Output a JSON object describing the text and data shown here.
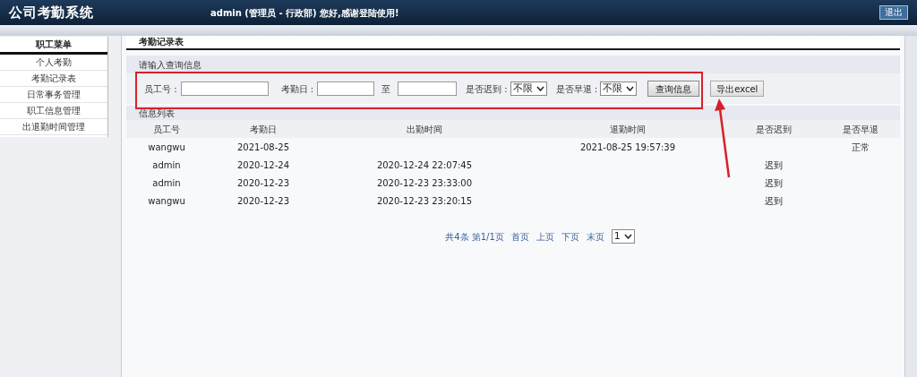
{
  "header": {
    "title": "公司考勤系统",
    "greeting": "admin (管理员 - 行政部) 您好,感谢登陆使用!",
    "logout": "退出"
  },
  "sidebar": {
    "heading": "职工菜单",
    "items": [
      "个人考勤",
      "考勤记录表",
      "日常事务管理",
      "职工信息管理",
      "出退勤时间管理"
    ]
  },
  "panel": {
    "title": "考勤记录表",
    "query_heading": "请输入查询信息",
    "filters": [
      {
        "kind": "input",
        "label": "员工号 :"
      },
      {
        "kind": "range",
        "label": "考勤日 :",
        "separator": "至"
      },
      {
        "kind": "select",
        "label": "是否迟到 :",
        "value": "不限"
      },
      {
        "kind": "select",
        "label": "是否早退 :",
        "value": "不限"
      }
    ],
    "buttons": [
      "查询信息",
      "导出excel"
    ],
    "list_heading": "信息列表",
    "table": {
      "columns": [
        "员工号",
        "考勤日",
        "出勤时间",
        "退勤时间",
        "是否迟到",
        "是否早退"
      ],
      "rows": [
        {
          "cells": [
            "wangwu",
            "2021-08-25",
            null,
            "2021-08-25 19:57:39",
            null,
            "正常"
          ]
        },
        {
          "cells": [
            "admin",
            "2020-12-24",
            "2020-12-24 22:07:45",
            null,
            "迟到",
            null
          ]
        },
        {
          "cells": [
            "admin",
            "2020-12-23",
            "2020-12-23 23:33:00",
            null,
            "迟到",
            null
          ]
        },
        {
          "cells": [
            "wangwu",
            "2020-12-23",
            "2020-12-23 23:20:15",
            null,
            "迟到",
            null
          ]
        }
      ]
    },
    "pagination": {
      "summary": "共4条 第1/1页",
      "links": [
        "首页",
        "上页",
        "下页",
        "末页"
      ],
      "page": "1"
    }
  }
}
